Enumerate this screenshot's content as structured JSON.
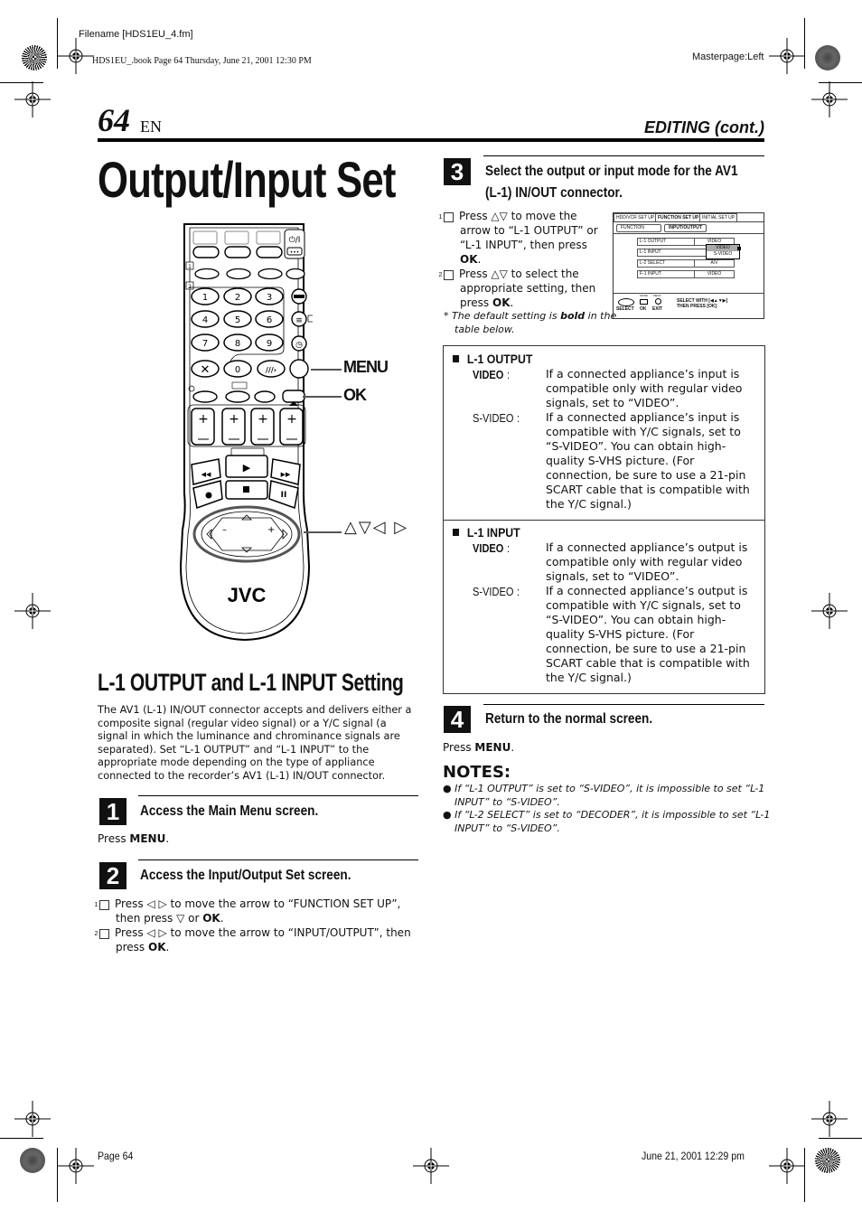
{
  "print_header": {
    "filename": "Filename [HDS1EU_4.fm]",
    "book_line": "HDS1EU_.book  Page 64  Thursday, June 21, 2001  12:30 PM",
    "masterpage": "Masterpage:Left"
  },
  "page_header": {
    "page_number": "64",
    "language": "EN",
    "section": "EDITING (cont.)"
  },
  "title": "Output/Input Set",
  "remote": {
    "brand": "JVC",
    "keys": [
      "1",
      "2",
      "3",
      "4",
      "5",
      "6",
      "7",
      "8",
      "9",
      "0"
    ],
    "power_label": "⏻/I",
    "callouts": {
      "menu": "MENU",
      "ok": "OK",
      "arrows": "△▽◁ ▷"
    },
    "step_markers": [
      "1",
      "2",
      "3",
      "4"
    ]
  },
  "subsection": {
    "title": "L-1 OUTPUT and L-1 INPUT Setting",
    "intro": "The AV1 (L-1) IN/OUT connector accepts and delivers either a composite signal (regular video signal) or a Y/C signal (a signal in which the luminance and chrominance signals are separated). Set “L-1 OUTPUT” and “L-1 INPUT” to the appropriate mode depending on the type of appliance connected to the recorder’s AV1 (L-1) IN/OUT connector."
  },
  "steps": [
    {
      "num": "1",
      "title": "Access the Main Menu screen.",
      "press_prefix": "Press ",
      "press_key": "MENU",
      "press_suffix": "."
    },
    {
      "num": "2",
      "title": "Access the Input/Output Set screen.",
      "items": [
        {
          "n": "1",
          "pre": "Press ◁ ▷ to move the arrow to “FUNCTION SET UP”, then press ▽ or ",
          "key": "OK",
          "post": "."
        },
        {
          "n": "2",
          "pre": "Press ◁ ▷ to move the arrow to “INPUT/OUTPUT”, then press ",
          "key": "OK",
          "post": "."
        }
      ]
    },
    {
      "num": "3",
      "title_line1": "Select the output or input mode for the AV1",
      "title_line2": "(L-1) IN/OUT connector.",
      "items": [
        {
          "n": "1",
          "pre": "Press △▽ to move the arrow to “L-1 OUTPUT” or “L-1 INPUT”, then press ",
          "key": "OK",
          "post": "."
        },
        {
          "n": "2",
          "pre": "Press △▽ to select the appropriate setting, then press ",
          "key": "OK",
          "post": "."
        }
      ],
      "footnote_pre": "*  The default setting is ",
      "footnote_bold": "bold",
      "footnote_post": " in the table below."
    },
    {
      "num": "4",
      "title": "Return to the normal screen.",
      "press_prefix": "Press ",
      "press_key": "MENU",
      "press_suffix": "."
    }
  ],
  "osd_screen": {
    "tabs": [
      "HDD/VCR SET UP",
      "FUNCTION SET UP",
      "INITIAL SET UP"
    ],
    "active_tab": "FUNCTION SET UP",
    "subtabs": [
      "FUNCTION",
      "INPUT/OUTPUT"
    ],
    "active_subtab": "INPUT/OUTPUT",
    "rows": [
      {
        "label": "L-1 OUTPUT",
        "value": "VIDEO"
      },
      {
        "label": "L-1 INPUT",
        "value": ""
      },
      {
        "label": "L-2 SELECT",
        "value": "A/V"
      },
      {
        "label": "F-1 INPUT",
        "value": "VIDEO"
      }
    ],
    "dropdown_options": [
      "VIDEO",
      "S-VIDEO"
    ],
    "dropdown_selected": "VIDEO",
    "footer": {
      "select": "SELECT",
      "ok": "OK",
      "exit": "EXIT",
      "ok_small": "MODE",
      "exit_small": "MENU",
      "hint_line1": "SELECT WITH [◀▲▼▶]",
      "hint_line2": "THEN PRESS [OK]"
    }
  },
  "settings_table": [
    {
      "heading": "L-1 OUTPUT",
      "options": [
        {
          "key": "VIDEO",
          "default": true,
          "desc": "If a connected appliance’s input is compatible only with regular video signals, set to “VIDEO”."
        },
        {
          "key": "S-VIDEO",
          "default": false,
          "desc": "If a connected appliance’s input is compatible with Y/C signals, set to “S-VIDEO”. You can obtain high-quality S-VHS picture. (For connection, be sure to use a 21-pin SCART cable that is compatible with the Y/C signal.)"
        }
      ]
    },
    {
      "heading": "L-1 INPUT",
      "options": [
        {
          "key": "VIDEO",
          "default": true,
          "desc": "If a connected appliance’s output is compatible only with regular video signals, set to “VIDEO”."
        },
        {
          "key": "S-VIDEO",
          "default": false,
          "desc": "If a connected appliance’s output is compatible with Y/C signals, set to “S-VIDEO”. You can obtain high-quality S-VHS picture. (For connection, be sure to use a 21-pin SCART cable that is compatible with the Y/C signal.)"
        }
      ]
    }
  ],
  "notes": {
    "title": "NOTES:",
    "items": [
      "If “L-1 OUTPUT” is set to “S-VIDEO”, it is impossible to set “L-1 INPUT” to “S-VIDEO”.",
      "If “L-2 SELECT” is set to “DECODER”, it is impossible to set “L-1 INPUT” to “S-VIDEO”."
    ]
  },
  "footer": {
    "page": "Page 64",
    "date": "June 21, 2001 12:29 pm"
  }
}
